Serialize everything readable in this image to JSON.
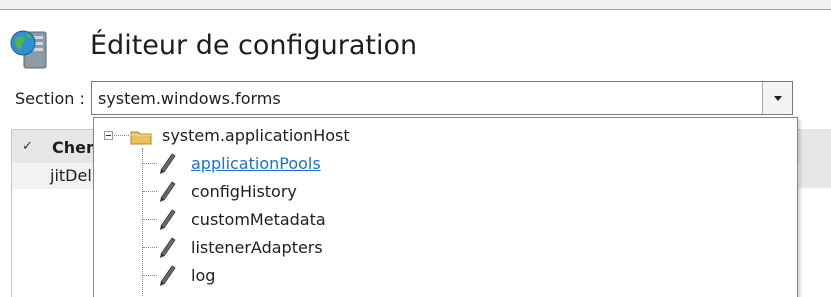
{
  "header": {
    "title": "Éditeur de configuration"
  },
  "section": {
    "label": "Section :",
    "value": "system.windows.forms"
  },
  "background_panel": {
    "header_text": "Chem",
    "row_text": "jitDel"
  },
  "tree": {
    "root": {
      "label": "system.applicationHost",
      "icon": "folder-icon",
      "expanded": true
    },
    "children": [
      {
        "label": "applicationPools",
        "icon": "pencil-icon",
        "hovered": true
      },
      {
        "label": "configHistory",
        "icon": "pencil-icon"
      },
      {
        "label": "customMetadata",
        "icon": "pencil-icon"
      },
      {
        "label": "listenerAdapters",
        "icon": "pencil-icon"
      },
      {
        "label": "log",
        "icon": "pencil-icon"
      }
    ]
  },
  "colors": {
    "link_hover": "#1a6fd8",
    "folder": "#e8c35a",
    "panel_header": "#e6e6e6"
  }
}
